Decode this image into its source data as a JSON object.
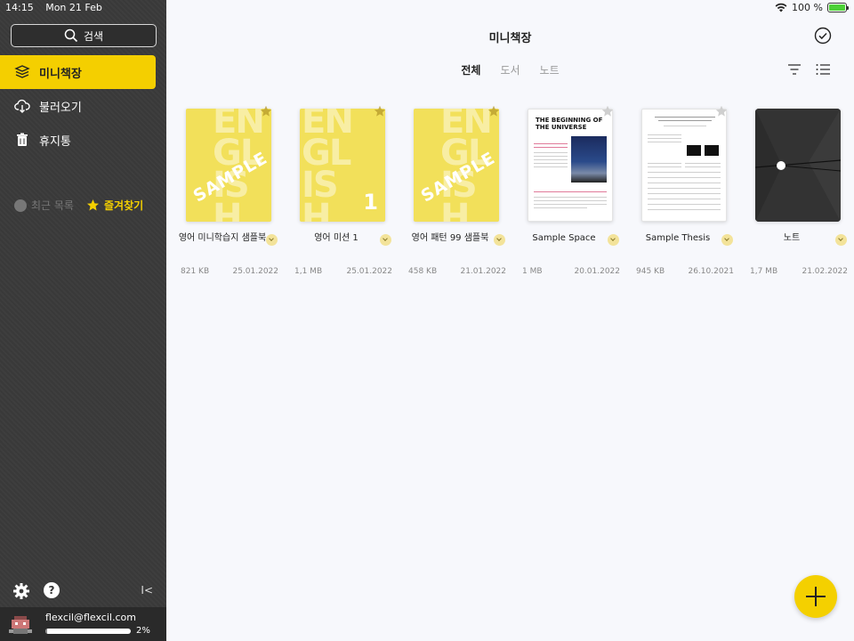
{
  "status": {
    "time": "14:15",
    "date": "Mon 21 Feb",
    "battery": "100 %"
  },
  "sidebar": {
    "search_label": "검색",
    "items": [
      {
        "label": "미니책장",
        "icon": "books-icon",
        "active": true
      },
      {
        "label": "불러오기",
        "icon": "cloud-download-icon",
        "active": false
      },
      {
        "label": "휴지통",
        "icon": "trash-icon",
        "active": false
      }
    ],
    "recent_label": "최근 목록",
    "favorites_label": "즐겨찾기",
    "collapse_label": "I<",
    "help_label": "?",
    "account": {
      "email": "flexcil@flexcil.com",
      "usage_percent": 2,
      "usage_label": "2%"
    }
  },
  "main": {
    "title": "미니책장",
    "tabs": [
      {
        "label": "전체",
        "active": true
      },
      {
        "label": "도서",
        "active": false
      },
      {
        "label": "노트",
        "active": false
      }
    ],
    "books": [
      {
        "name": "영어 미니학습지 샘플북",
        "size": "821 KB",
        "date": "25.01.2022",
        "cover": "yellow",
        "cover_text": "SAMPLE"
      },
      {
        "name": "영어 미션 1",
        "size": "1,1 MB",
        "date": "25.01.2022",
        "cover": "yellow",
        "cover_text": "1"
      },
      {
        "name": "영어 패턴 99 샘플북",
        "size": "458 KB",
        "date": "21.01.2022",
        "cover": "yellow",
        "cover_text": "SAMPLE"
      },
      {
        "name": "Sample Space",
        "size": "1 MB",
        "date": "20.01.2022",
        "cover": "paper",
        "cover_text": "THE BEGINNING OF THE UNIVERSE"
      },
      {
        "name": "Sample Thesis",
        "size": "945 KB",
        "date": "26.10.2021",
        "cover": "paper",
        "cover_text": ""
      },
      {
        "name": "노트",
        "size": "1,7 MB",
        "date": "21.02.2022",
        "cover": "dark",
        "cover_text": ""
      }
    ]
  },
  "colors": {
    "accent": "#f4cf00",
    "sidebar_bg": "#3a3a3a",
    "main_bg": "#f7f8fc"
  }
}
